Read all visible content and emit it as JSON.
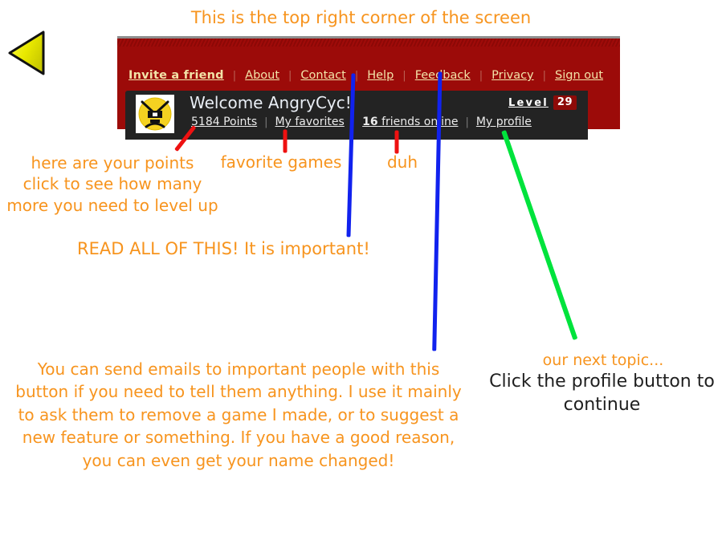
{
  "annotations": {
    "title": "This is the top right corner of the screen",
    "points_note": "here are your points\nclick to see how many\nmore you need to level up",
    "favorites_note": "favorite games",
    "friends_note": "duh",
    "read_all_note": "READ ALL OF THIS! It is important!",
    "email_paragraph": "You can send emails to important people with this button if you need to tell them anything. I use it mainly to ask them to remove a game I made, or to suggest a new feature or something. If you have a good reason, you can even get your name changed!",
    "next_topic_note": "our next topic...",
    "click_instruction": "Click the profile button\nto continue",
    "colors": {
      "orange_text": "#f7941e",
      "black_text": "#202020",
      "red_pointer": "#ee1111",
      "blue_pointer": "#1122ee",
      "green_pointer": "#00e33c",
      "triangle_yellow": "#e8e800"
    }
  },
  "site_header": {
    "nav_links": [
      {
        "label": "Invite a friend",
        "bold": true
      },
      {
        "label": "About",
        "bold": false
      },
      {
        "label": "Contact",
        "bold": false
      },
      {
        "label": "Help",
        "bold": false
      },
      {
        "label": "Feedback",
        "bold": false
      },
      {
        "label": "Privacy",
        "bold": false
      },
      {
        "label": "Sign out",
        "bold": false
      }
    ],
    "separator": "|",
    "user": {
      "welcome": "Welcome AngryCyc!",
      "points": "5184 Points",
      "favorites": "My favorites",
      "friends_count": "16",
      "friends_label": " friends online",
      "profile": "My profile"
    },
    "level": {
      "word": "Level",
      "value": "29"
    },
    "colors": {
      "red_band": "#9c0b09",
      "dark_panel": "#232323",
      "nav_link": "#f3e3a8",
      "level_chip": "#8d0a08"
    }
  }
}
